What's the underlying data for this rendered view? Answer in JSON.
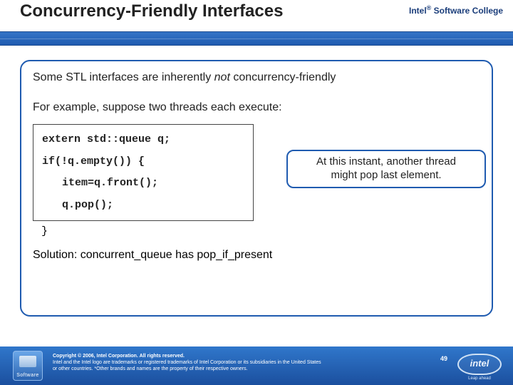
{
  "brand": {
    "name": "Intel",
    "reg": "®",
    "suffix": " Software College"
  },
  "title": "Concurrency-Friendly Interfaces",
  "body": {
    "line1_pre": "Some STL interfaces are inherently ",
    "line1_not": "not",
    "line1_post": " concurrency-friendly",
    "line2": "For example, suppose two threads each execute:",
    "code": {
      "l1": "extern std::queue q;",
      "l2": "if(!q.empty()) {",
      "l3": "item=q.front();",
      "l4": "q.pop();",
      "l5": "}"
    },
    "callout1": "At this instant, another thread",
    "callout2": "might pop last element.",
    "solution_pre": "Solution: ",
    "solution_api1": "concurrent_queue",
    "solution_mid": " has ",
    "solution_api2": "pop_if_present"
  },
  "footer": {
    "badge_label": "Software",
    "copy_l1": "Copyright © 2006, Intel Corporation. All rights reserved.",
    "copy_l2": "Intel and the Intel logo are trademarks or registered trademarks of Intel Corporation or its subsidiaries in the United States",
    "copy_l3": "or other countries. *Other brands and names are the property of their respective owners.",
    "page": "49",
    "logo_text": "intel",
    "logo_tag": "Leap ahead"
  }
}
